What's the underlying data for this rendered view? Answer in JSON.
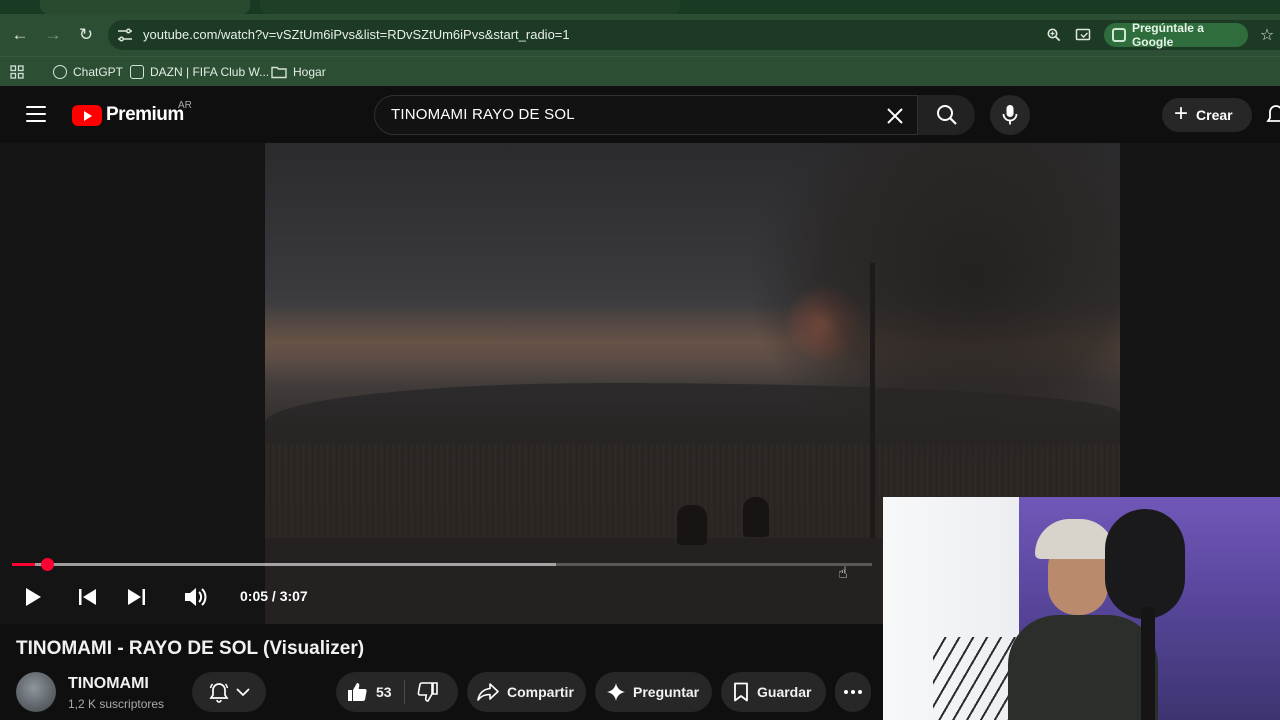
{
  "browser": {
    "url": "youtube.com/watch?v=vSZtUm6iPvs&list=RDvSZtUm6iPvs&start_radio=1",
    "google_button": "Pregúntale a Google",
    "bookmarks": [
      {
        "label": "ChatGPT"
      },
      {
        "label": "DAZN | FIFA Club W..."
      },
      {
        "label": "Hogar"
      }
    ]
  },
  "header": {
    "logo_text": "Premium",
    "region": "AR",
    "search_query": "TINOMAMI RAYO DE SOL",
    "create_label": "Crear"
  },
  "player": {
    "time_display": "0:05 / 3:07",
    "progress_fraction": 0.027,
    "buffer_fraction": 0.632,
    "accent_color": "#ff0033"
  },
  "video": {
    "title": "TINOMAMI - RAYO DE SOL (Visualizer)",
    "channel_name": "TINOMAMI",
    "subscribers": "1,2 K suscriptores",
    "likes": "53",
    "share_label": "Compartir",
    "ask_label": "Preguntar",
    "save_label": "Guardar"
  }
}
